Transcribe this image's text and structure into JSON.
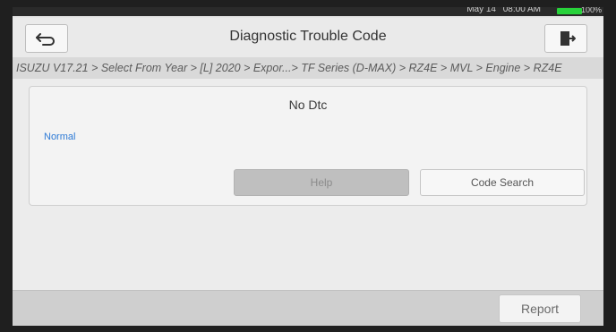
{
  "status_bar": {
    "date": "May 14",
    "time": "08:00",
    "time_suffix": "AM",
    "battery": "100%"
  },
  "header": {
    "title": "Diagnostic Trouble Code"
  },
  "breadcrumb": {
    "text": "ISUZU V17.21 > Select From Year > [L] 2020 > Expor...> TF Series (D-MAX) > RZ4E > MVL > Engine > RZ4E"
  },
  "result": {
    "dtc_text": "No Dtc",
    "status_text": "Normal"
  },
  "buttons": {
    "help": "Help",
    "code_search": "Code Search",
    "report": "Report"
  },
  "colors": {
    "status_text": "#2d7ad6"
  }
}
